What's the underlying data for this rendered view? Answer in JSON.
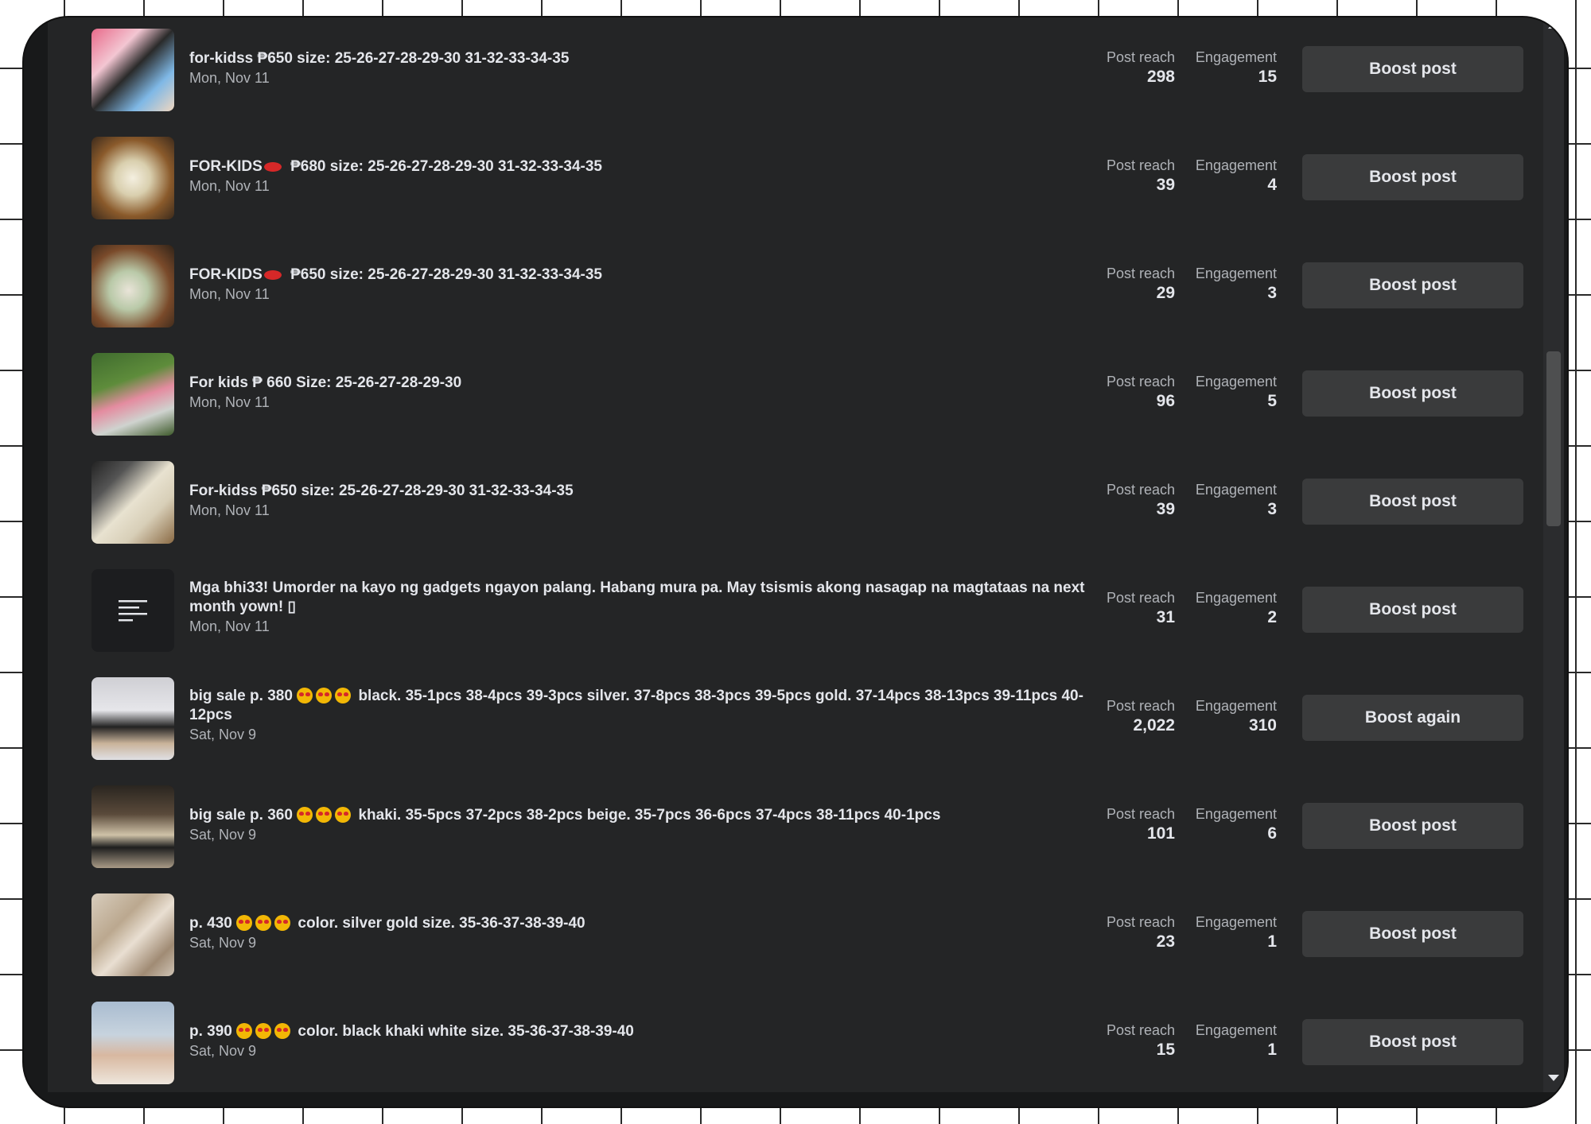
{
  "labels": {
    "post_reach": "Post reach",
    "engagement": "Engagement"
  },
  "colors": {
    "background": "#242526",
    "button": "#3a3b3c",
    "text": "#e4e6eb",
    "muted": "#b0b3b8"
  },
  "posts": [
    {
      "title": "for-kidss ₱650 size: 25-26-27-28-29-30 31-32-33-34-35",
      "date": "Mon, Nov 11",
      "reach": "298",
      "engagement": "15",
      "action": "Boost post",
      "thumb": "photo"
    },
    {
      "title_pre": "FOR-KIDS",
      "title_post": " ₱680 size: 25-26-27-28-29-30 31-32-33-34-35",
      "date": "Mon, Nov 11",
      "reach": "39",
      "engagement": "4",
      "action": "Boost post",
      "thumb": "photo"
    },
    {
      "title_pre": "FOR-KIDS",
      "title_post": " ₱650 size: 25-26-27-28-29-30 31-32-33-34-35",
      "date": "Mon, Nov 11",
      "reach": "29",
      "engagement": "3",
      "action": "Boost post",
      "thumb": "photo"
    },
    {
      "title": "For kids ₱ 660 Size: 25-26-27-28-29-30",
      "date": "Mon, Nov 11",
      "reach": "96",
      "engagement": "5",
      "action": "Boost post",
      "thumb": "photo"
    },
    {
      "title": "For-kidss ₱650 size: 25-26-27-28-29-30 31-32-33-34-35",
      "date": "Mon, Nov 11",
      "reach": "39",
      "engagement": "3",
      "action": "Boost post",
      "thumb": "photo"
    },
    {
      "title": "Mga bhi33! Umorder na kayo ng gadgets ngayon palang. Habang mura pa. May tsismis akong nasagap na magtataas na next month yown! ▯",
      "date": "Mon, Nov 11",
      "reach": "31",
      "engagement": "2",
      "action": "Boost post",
      "thumb": "text"
    },
    {
      "title_pre": "big sale p. 380 ",
      "title_post": " black. 35-1pcs 38-4pcs 39-3pcs silver. 37-8pcs 38-3pcs 39-5pcs gold. 37-14pcs 38-13pcs 39-11pcs 40-12pcs",
      "date": "Sat, Nov 9",
      "reach": "2,022",
      "engagement": "310",
      "action": "Boost again",
      "thumb": "photo"
    },
    {
      "title_pre": "big sale p. 360 ",
      "title_post": " khaki. 35-5pcs 37-2pcs 38-2pcs beige. 35-7pcs 36-6pcs 37-4pcs 38-11pcs 40-1pcs",
      "date": "Sat, Nov 9",
      "reach": "101",
      "engagement": "6",
      "action": "Boost post",
      "thumb": "photo"
    },
    {
      "title_pre": "p. 430 ",
      "title_post": " color. silver gold size. 35-36-37-38-39-40",
      "date": "Sat, Nov 9",
      "reach": "23",
      "engagement": "1",
      "action": "Boost post",
      "thumb": "photo"
    },
    {
      "title_pre": "p. 390 ",
      "title_post": " color. black khaki white size. 35-36-37-38-39-40",
      "date": "Sat, Nov 9",
      "reach": "15",
      "engagement": "1",
      "action": "Boost post",
      "thumb": "photo"
    }
  ]
}
